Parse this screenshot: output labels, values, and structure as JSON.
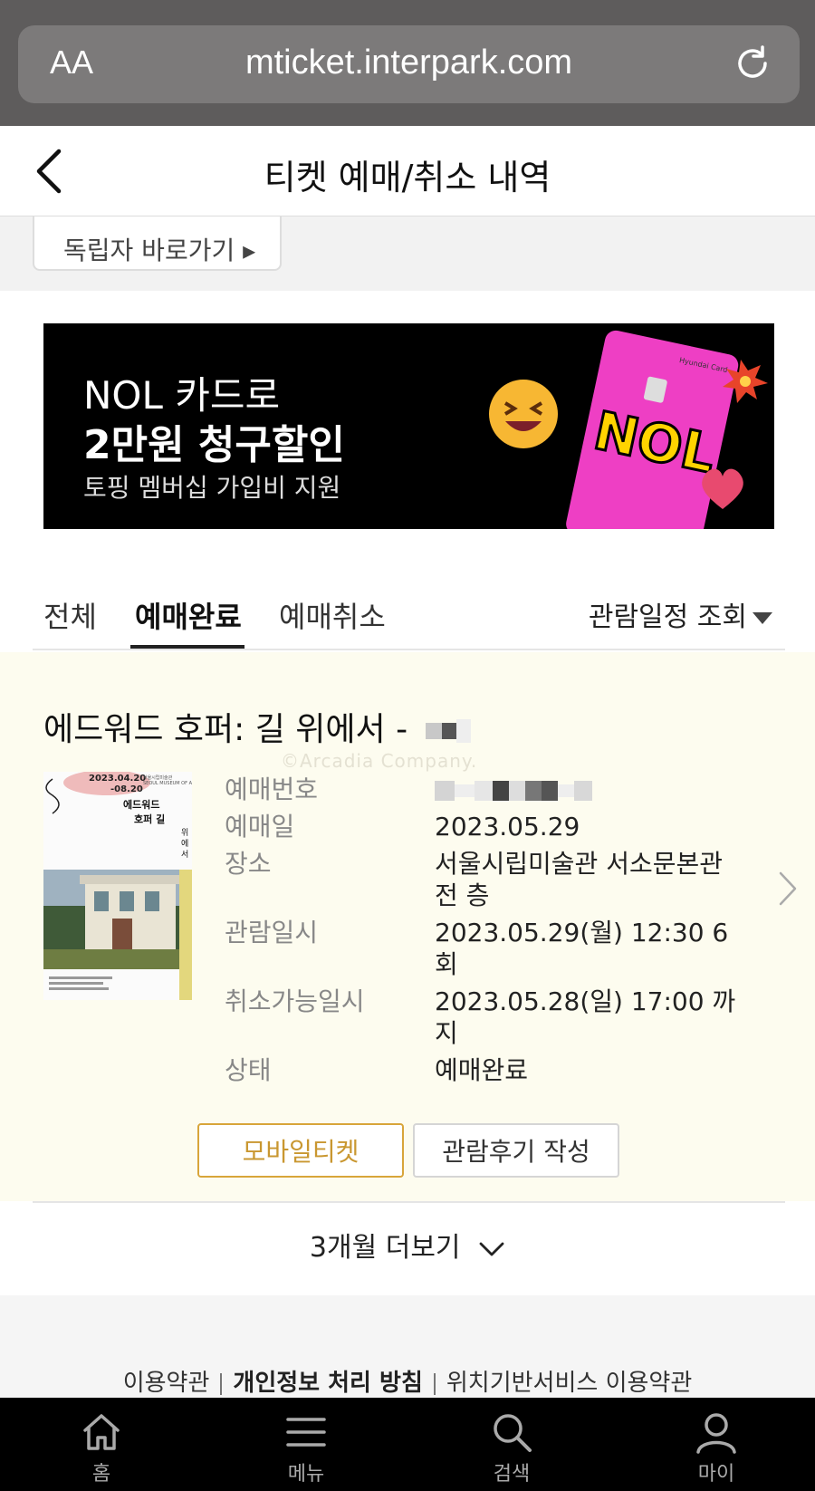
{
  "browser": {
    "aa_label": "AA",
    "url": "mticket.interpark.com"
  },
  "header": {
    "title": "티켓 예매/취소 내역"
  },
  "top_partial_button": {
    "label": "독립자 바로가기 ▸"
  },
  "banner": {
    "line1": "NOL 카드로",
    "line2": "2만원 청구할인",
    "line3": "토핑 멤버십 가입비 지원",
    "card_text": "NOL",
    "card_brand": "Hyundai Card"
  },
  "tabs": [
    {
      "label": "전체",
      "active": false
    },
    {
      "label": "예매완료",
      "active": true
    },
    {
      "label": "예매취소",
      "active": false
    }
  ],
  "filter": {
    "label": "관람일정 조회"
  },
  "booking": {
    "title": "에드워드 호퍼: 길 위에서 -",
    "watermark": "©Arcadia Company.",
    "poster": {
      "dates": "2023.04.20\n-08.20",
      "museum": "서울시립미술관 SEOUL MUSEUM OF ART",
      "title": "에드워드 호퍼 길 위에서"
    },
    "rows": [
      {
        "key": "예매번호",
        "value": ""
      },
      {
        "key": "예매일",
        "value": "2023.05.29"
      },
      {
        "key": "장소",
        "value": "서울시립미술관 서소문본관 전 층"
      },
      {
        "key": "관람일시",
        "value": "2023.05.29(월) 12:30 6회"
      },
      {
        "key": "취소가능일시",
        "value": "2023.05.28(일) 17:00 까지"
      },
      {
        "key": "상태",
        "value": "예매완료"
      }
    ],
    "btn_mobile": "모바일티켓",
    "btn_review": "관람후기 작성"
  },
  "more": {
    "label": "3개월 더보기"
  },
  "footer": {
    "links": [
      "이용약관",
      "개인정보 처리 방침",
      "위치기반서비스 이용약관"
    ]
  },
  "bottom_nav": [
    {
      "label": "홈",
      "icon": "home-icon"
    },
    {
      "label": "메뉴",
      "icon": "menu-icon"
    },
    {
      "label": "검색",
      "icon": "search-icon"
    },
    {
      "label": "마이",
      "icon": "person-icon"
    }
  ],
  "colors": {
    "card_bg": "#fdfcef",
    "mobile_ticket_accent": "#d8a53a",
    "banner_card_pink": "#ee3fc4"
  }
}
